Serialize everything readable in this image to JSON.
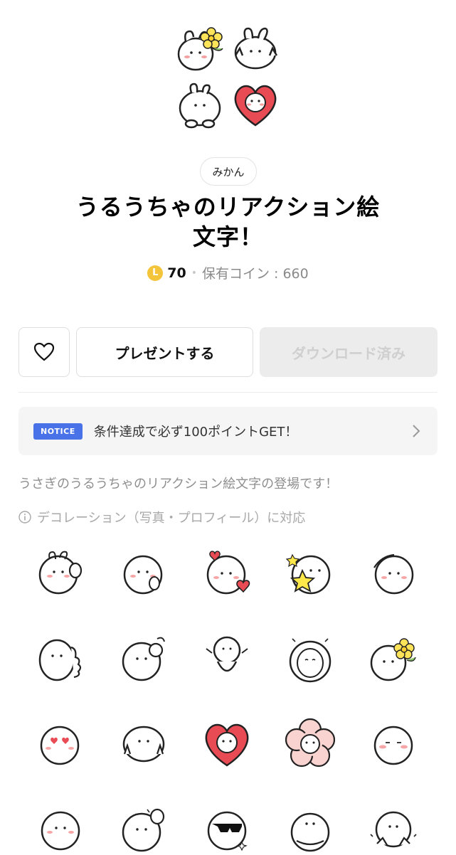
{
  "author": "みかん",
  "title_line1": "うるうちゃのリアクション絵",
  "title_line2": "文字！",
  "price": {
    "coin_label": "L",
    "amount": "70",
    "separator": "•",
    "owned_coins": "保有コイン : 660"
  },
  "buttons": {
    "like_icon": "heart-outline-icon",
    "gift": "プレゼントする",
    "download": "ダウンロード済み"
  },
  "notice": {
    "badge": "NOTICE",
    "text": "条件達成で必ず100ポイントGET！",
    "chevron_icon": "chevron-right-icon"
  },
  "description": "うさぎのうるうちゃのリアクション絵文字の登場です！",
  "decoration": "デコレーション（写真・プロフィール）に対応",
  "colors": {
    "accent_blue": "#4a72e8",
    "coin_yellow": "#f4c43a",
    "heart_red": "#e94b55",
    "flower_pink": "#f9d3cf",
    "star_yellow": "#ffe94a"
  },
  "emoji_grid": [
    [
      "bunny-waving",
      "bunny-kissing",
      "bunny-with-hearts",
      "bunny-with-star",
      "bunny-saluting"
    ],
    [
      "bunny-thumbs-up",
      "bunny-ok-sign",
      "bunny-standing",
      "bunny-peeking",
      "bunny-with-flower"
    ],
    [
      "bunny-heart-eyes",
      "bunny-peace-signs",
      "bunny-in-heart",
      "bunny-in-flower",
      "bunny-blushing"
    ],
    [
      "bunny-smiling",
      "bunny-waving-sweat",
      "bunny-sunglasses",
      "bunny-hugging",
      "bunny-clapping"
    ]
  ]
}
